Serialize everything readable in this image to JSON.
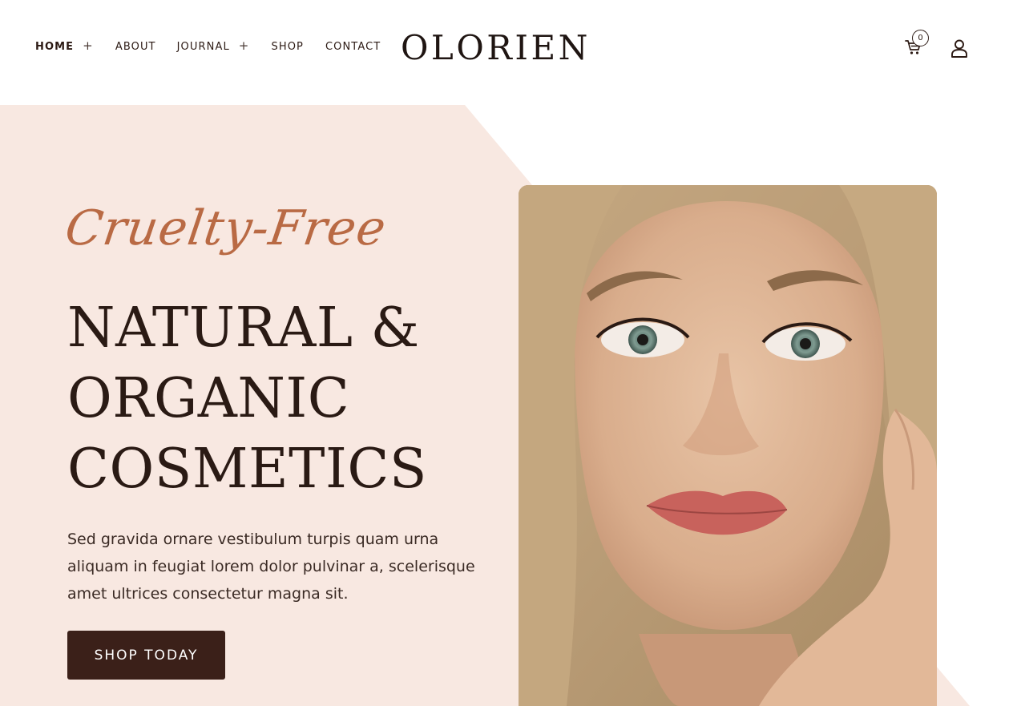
{
  "nav": {
    "items": [
      {
        "label": "HOME",
        "has_submenu": true,
        "active": true
      },
      {
        "label": "ABOUT",
        "has_submenu": false,
        "active": false
      },
      {
        "label": "JOURNAL",
        "has_submenu": true,
        "active": false
      },
      {
        "label": "SHOP",
        "has_submenu": false,
        "active": false
      },
      {
        "label": "CONTACT",
        "has_submenu": false,
        "active": false
      }
    ],
    "submenu_symbol": "+"
  },
  "logo": "OLORIEN",
  "header_actions": {
    "cart_icon": "cart-icon",
    "cart_count": "0",
    "account_icon": "user-icon"
  },
  "hero": {
    "script_title": "Cruelty-Free",
    "headline_lines": [
      "NATURAL &",
      "ORGANIC",
      "COSMETICS"
    ],
    "description": "Sed gravida ornare vestibulum turpis quam urna aliquam in feugiat lorem dolor pulvinar a, scelerisque amet ultrices consectetur magna sit.",
    "cta_label": "SHOP TODAY",
    "image_subject": "woman portrait"
  },
  "colors": {
    "hero_bg": "#f8e8e1",
    "script_accent": "#b96a44",
    "text_dark": "#2a1a14",
    "button_bg": "#3b2019",
    "button_text": "#ffffff"
  }
}
